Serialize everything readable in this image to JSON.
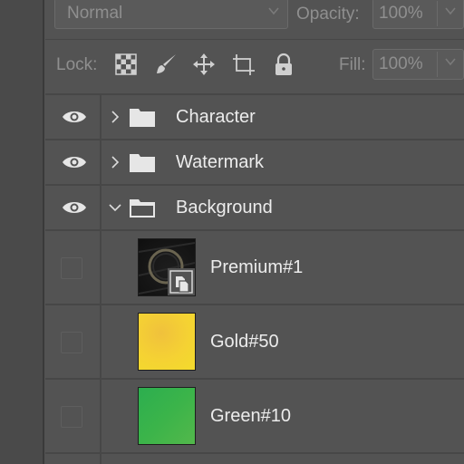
{
  "panel_header": {
    "blend_mode": "Normal",
    "opacity_label": "Opacity:",
    "opacity_value": "100%",
    "lock_label": "Lock:",
    "fill_label": "Fill:",
    "fill_value": "100%",
    "lock_icons": [
      "lock-transparent-pixels-icon",
      "lock-image-pixels-icon",
      "lock-position-icon",
      "lock-artboard-icon",
      "lock-all-icon"
    ]
  },
  "layers": [
    {
      "name": "Character",
      "kind": "group",
      "visible": true,
      "expanded": false,
      "icon": "folder-icon"
    },
    {
      "name": "Watermark",
      "kind": "group",
      "visible": true,
      "expanded": false,
      "icon": "folder-icon"
    },
    {
      "name": "Background",
      "kind": "group",
      "visible": true,
      "expanded": true,
      "icon": "folder-open-icon"
    },
    {
      "name": "Premium#1",
      "kind": "smart-object",
      "visible": false,
      "thumbnail": "dark-ring-smart-object"
    },
    {
      "name": "Gold#50",
      "kind": "fill",
      "visible": false,
      "thumbnail_color": "#f4d22f"
    },
    {
      "name": "Green#10",
      "kind": "fill",
      "visible": false,
      "thumbnail_color": "#3cb34b"
    }
  ],
  "colors": {
    "panel_bg": "#535353",
    "divider": "#474747",
    "text": "#ececec",
    "muted_text": "#8f8f8f"
  }
}
